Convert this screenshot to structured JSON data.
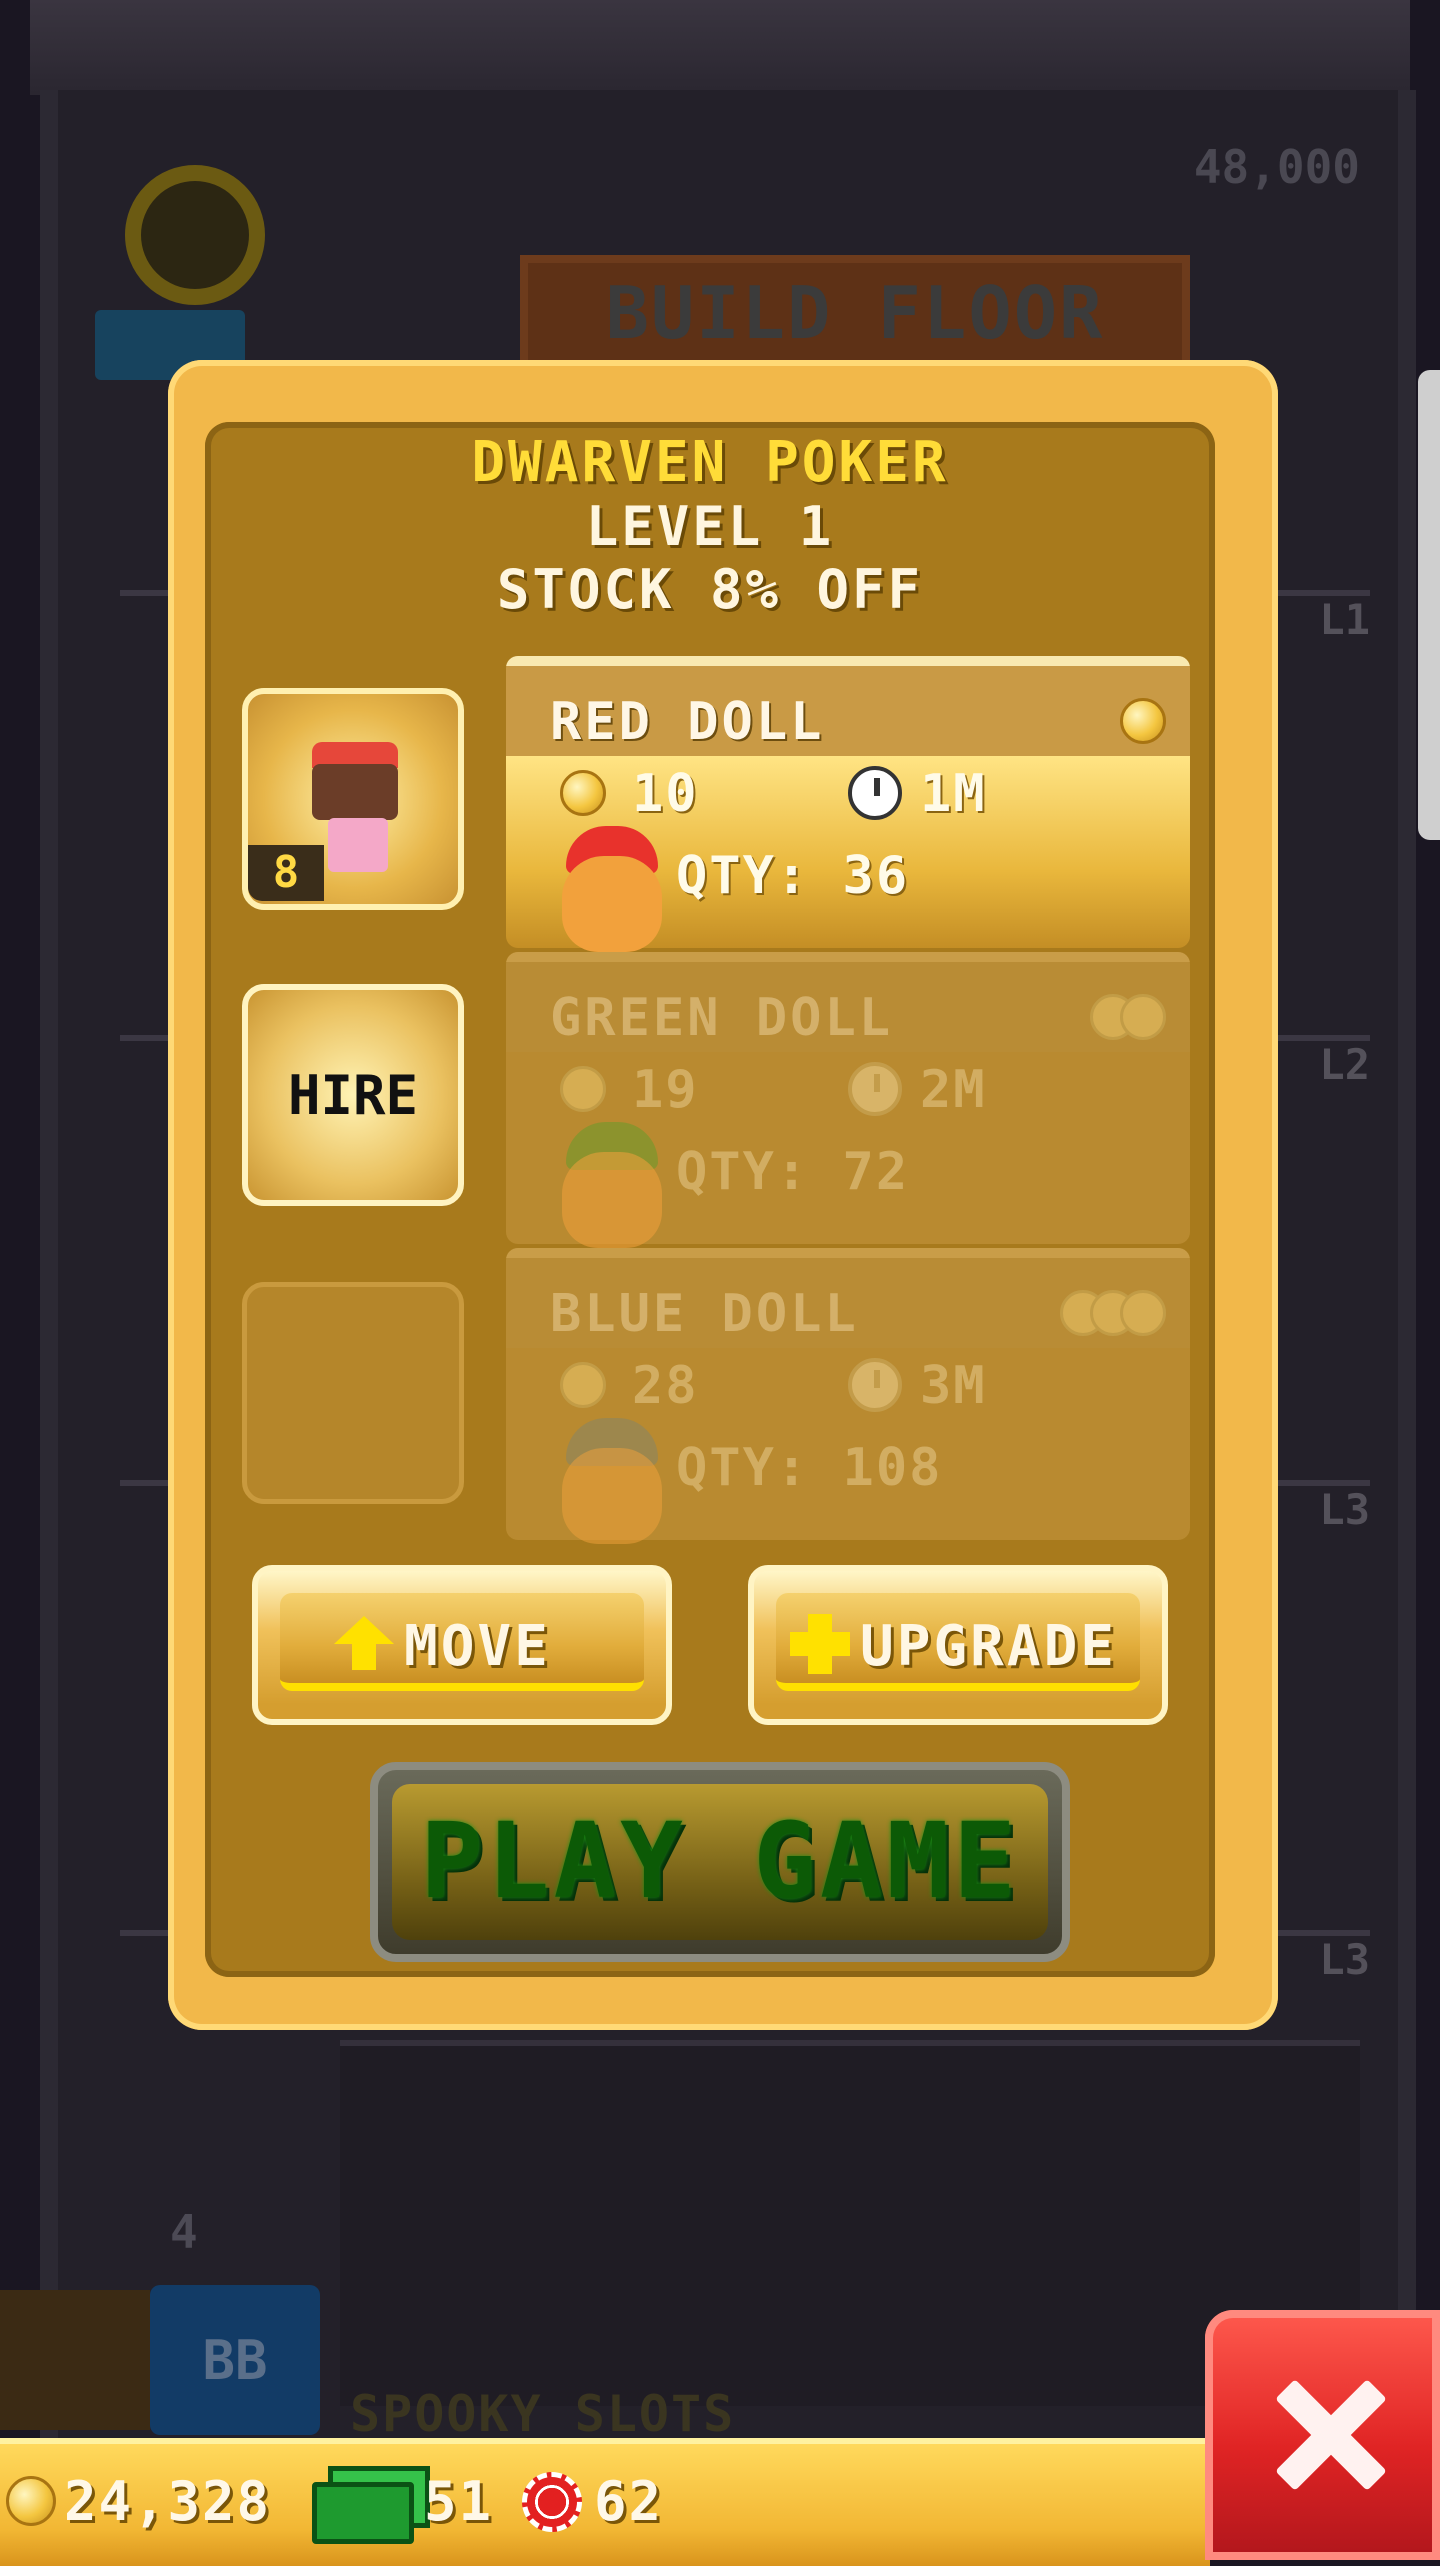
{
  "background": {
    "floor_cost": "48,000",
    "build_floor_label": "BUILD FLOOR",
    "floor_tags": [
      "L1",
      "L2",
      "L3",
      "L3"
    ],
    "elevator_floor": "4",
    "bitbook_label": "BB",
    "spooky_label": "SPOOKY SLOTS"
  },
  "modal": {
    "title": "DWARVEN POKER",
    "level": "LEVEL 1",
    "stock": "STOCK 8% OFF",
    "worker_level": "8",
    "hire_label": "HIRE",
    "products": [
      {
        "name": "RED DOLL",
        "cost": "10",
        "time": "1M",
        "qty": "QTY: 36",
        "hat_color": "#e8322c",
        "active": true
      },
      {
        "name": "GREEN DOLL",
        "cost": "19",
        "time": "2M",
        "qty": "QTY: 72",
        "hat_color": "#6e9a2c",
        "active": false
      },
      {
        "name": "BLUE DOLL",
        "cost": "28",
        "time": "3M",
        "qty": "QTY: 108",
        "hat_color": "#8a8560",
        "active": false
      }
    ],
    "move_label": "MOVE",
    "upgrade_label": "UPGRADE",
    "play_label": "PLAY GAME"
  },
  "status_bar": {
    "coins": "24,328",
    "bux": "51",
    "chips": "62"
  },
  "colors": {
    "gold": "#f2b84a",
    "title_yellow": "#ffdc38",
    "play_green": "#0c5a06",
    "close_red": "#e02424"
  }
}
